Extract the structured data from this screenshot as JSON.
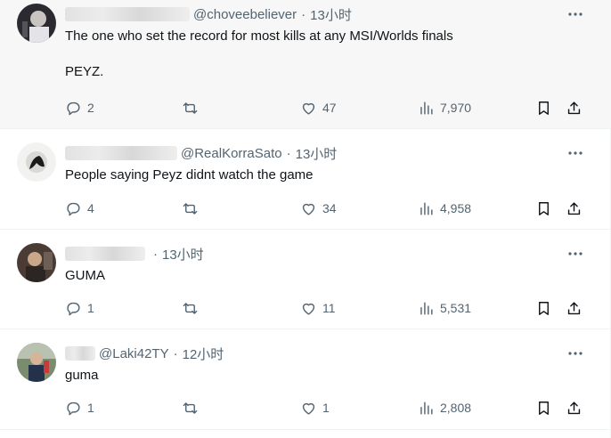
{
  "colors": {
    "text": "#0f1419",
    "muted": "#536471",
    "highlight_bg": "#f7f7f7",
    "divider": "#eff3f4"
  },
  "icons": {
    "more": "more-horizontal-icon",
    "reply": "reply-icon",
    "retweet": "retweet-icon",
    "like": "heart-icon",
    "views": "bar-chart-icon",
    "bookmark": "bookmark-icon",
    "share": "share-icon"
  },
  "tweets": [
    {
      "handle": "@choveebeliever",
      "dot": "·",
      "time": "13小时",
      "text": "The one who set the record for most kills at any MSI/Worlds finals\n\nPEYZ.",
      "replies": "2",
      "likes": "47",
      "views": "7,970"
    },
    {
      "handle": "@RealKorraSato",
      "dot": "·",
      "time": "13小时",
      "text": "People saying Peyz didnt watch the game",
      "replies": "4",
      "likes": "34",
      "views": "4,958"
    },
    {
      "handle": "",
      "dot": "·",
      "time": "13小时",
      "text": "GUMA",
      "replies": "1",
      "likes": "11",
      "views": "5,531"
    },
    {
      "handle": "@Laki42TY",
      "dot": "·",
      "time": "12小时",
      "text": "guma",
      "replies": "1",
      "likes": "1",
      "views": "2,808"
    }
  ]
}
